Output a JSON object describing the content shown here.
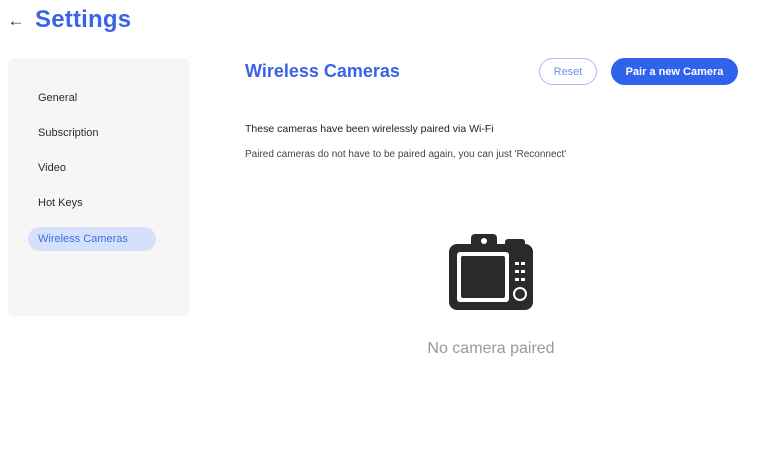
{
  "header": {
    "back_icon": "←",
    "title": "Settings"
  },
  "sidebar": {
    "items": [
      {
        "label": "General",
        "active": false
      },
      {
        "label": "Subscription",
        "active": false
      },
      {
        "label": "Video",
        "active": false
      },
      {
        "label": "Hot Keys",
        "active": false
      },
      {
        "label": "Wireless Cameras",
        "active": true
      }
    ]
  },
  "main": {
    "title": "Wireless Cameras",
    "reset_label": "Reset",
    "pair_label": "Pair a new Camera",
    "description_1": "These cameras have been wirelessly paired via Wi-Fi",
    "description_2": "Paired cameras do not have to be paired again, you can just 'Reconnect'",
    "empty_icon": "camera-icon",
    "empty_text": "No camera paired"
  },
  "colors": {
    "accent": "#3a63e6",
    "primary_button": "#2f63ee",
    "active_nav_bg": "#d5e0fb",
    "sidebar_bg": "#f6f6f7",
    "empty_text": "#9a9a9a"
  }
}
